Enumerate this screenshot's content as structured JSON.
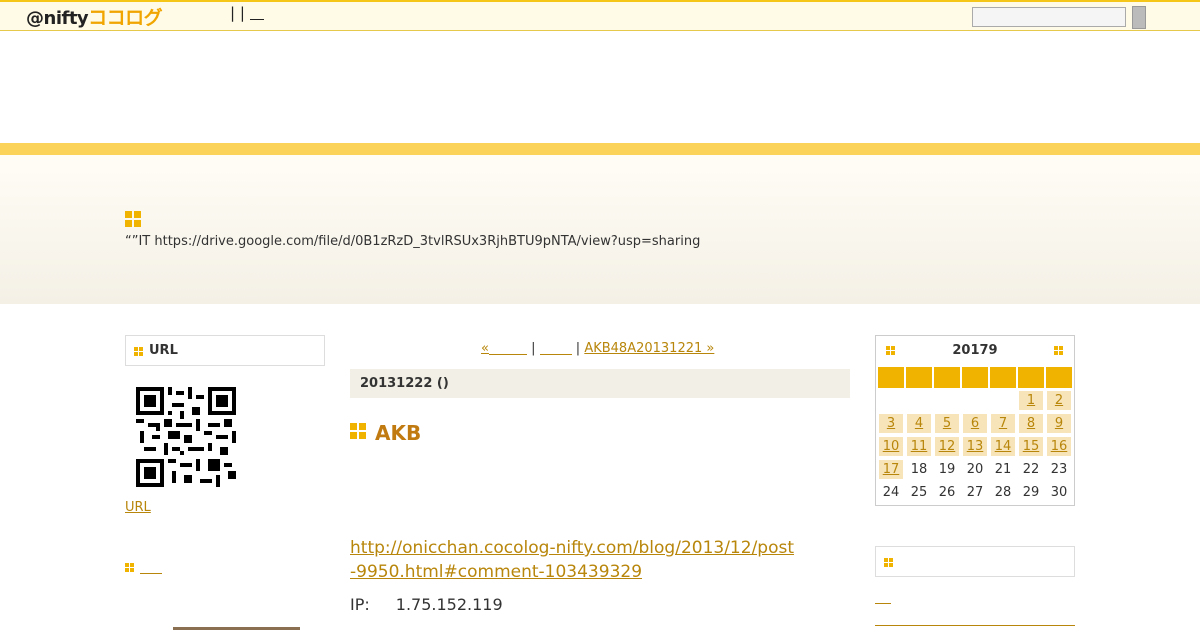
{
  "topbar": {
    "logo_prefix": "@nifty",
    "logo_brand": "ココログ",
    "links_text": "| |"
  },
  "header": {
    "description": "“”IT  https://drive.google.com/file/d/0B1zRzD_3tvlRSUx3RjhBTU9pNTA/view?usp=sharing"
  },
  "sidebar": {
    "qr_title": "URL",
    "url_link": "URL"
  },
  "pager": {
    "prev": "«",
    "sep1": "|",
    "sep2": "|",
    "next": "AKB48A20131221 »"
  },
  "entry": {
    "date": "20131222 ()",
    "title": "AKB",
    "link": "http://onicchan.cocolog-nifty.com/blog/2013/12/post-9950.html#comment-103439329",
    "ip_label": "IP:",
    "ip_value": "1.75.152.119"
  },
  "calendar": {
    "title": "20179",
    "weeks": [
      [
        "",
        "",
        "",
        "",
        "",
        "1",
        "2"
      ],
      [
        "3",
        "4",
        "5",
        "6",
        "7",
        "8",
        "9"
      ],
      [
        "10",
        "11",
        "12",
        "13",
        "14",
        "15",
        "16"
      ],
      [
        "17",
        "18",
        "19",
        "20",
        "21",
        "22",
        "23"
      ],
      [
        "24",
        "25",
        "26",
        "27",
        "28",
        "29",
        "30"
      ]
    ],
    "linked_days": [
      "1",
      "2",
      "3",
      "4",
      "5",
      "6",
      "7",
      "8",
      "9",
      "10",
      "11",
      "12",
      "13",
      "14",
      "15",
      "16",
      "17"
    ]
  },
  "colors": {
    "accent": "#f0b400",
    "band": "#fbd25a",
    "link": "#b8860b",
    "title": "#c07a10"
  }
}
